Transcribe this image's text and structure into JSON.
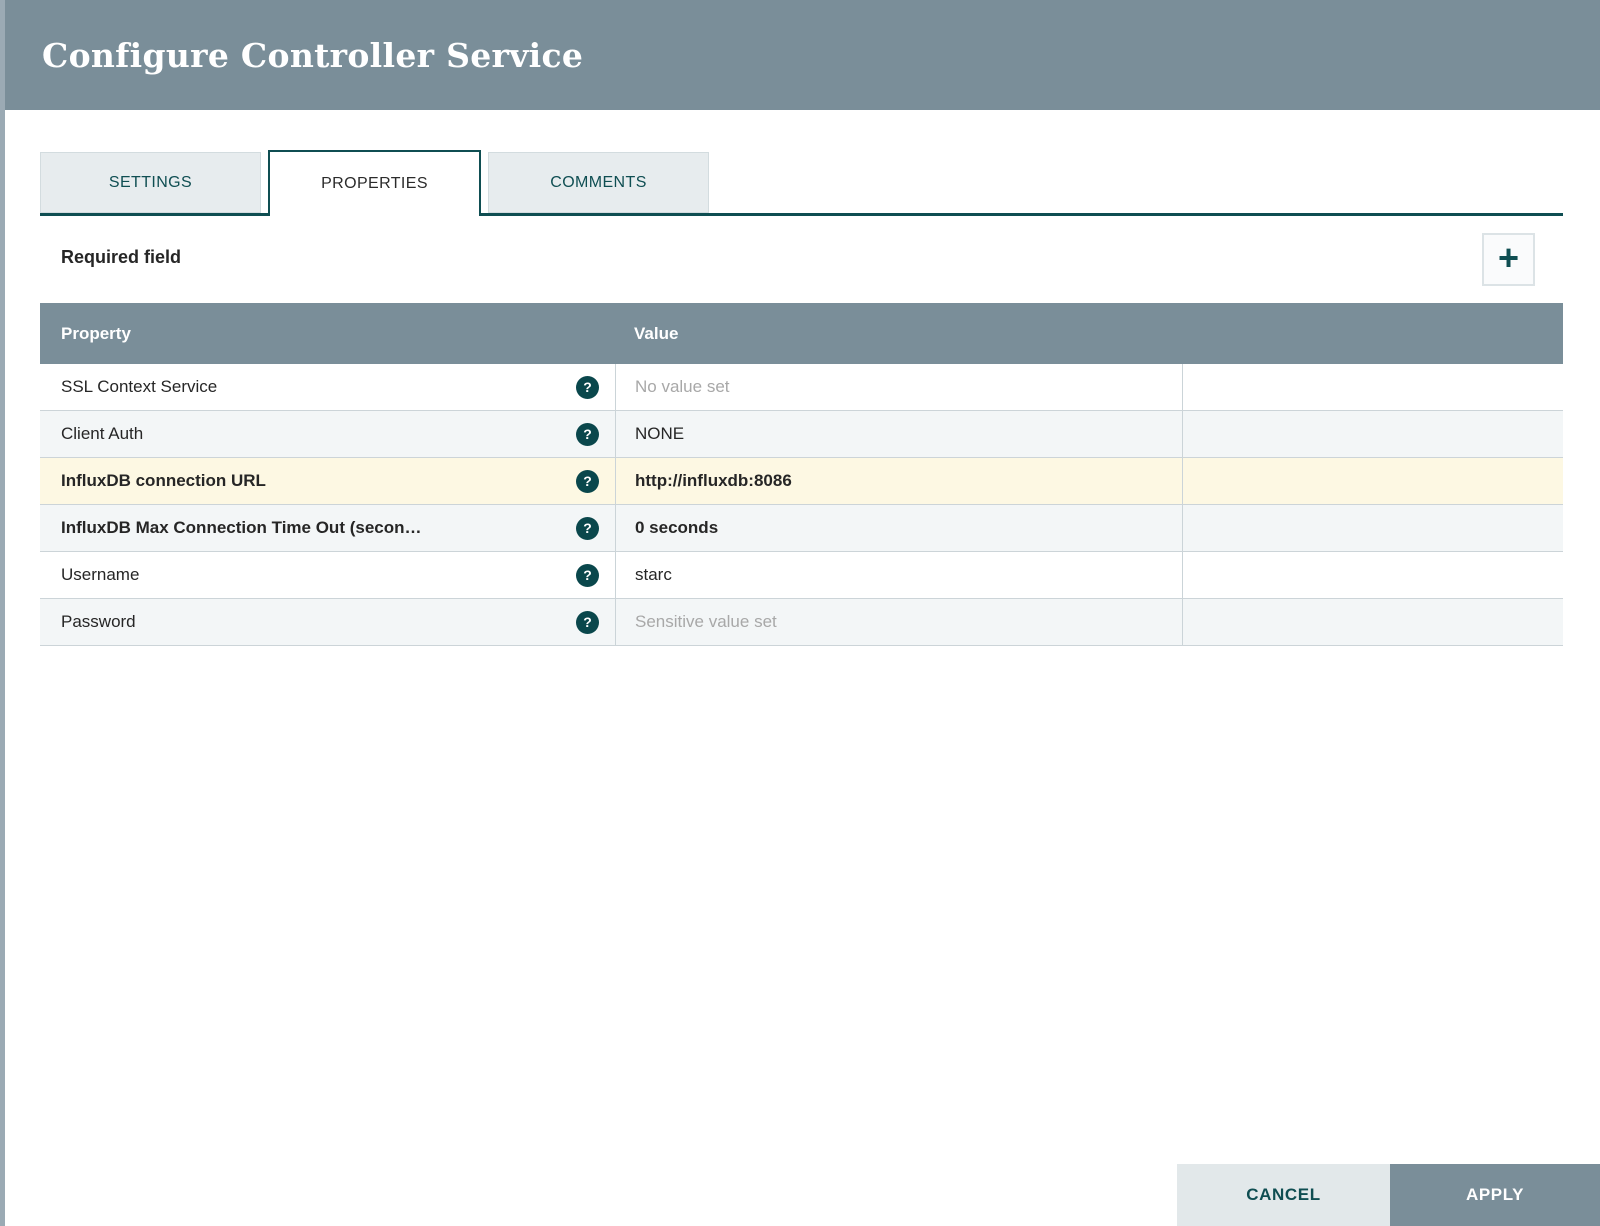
{
  "dialog": {
    "title": "Configure Controller Service",
    "tabs": [
      {
        "label": "SETTINGS",
        "active": false
      },
      {
        "label": "PROPERTIES",
        "active": true
      },
      {
        "label": "COMMENTS",
        "active": false
      }
    ],
    "required_label": "Required field",
    "add_button_icon": "+",
    "table": {
      "columns": {
        "property": "Property",
        "value": "Value"
      },
      "help_icon": "?",
      "rows": [
        {
          "property": "SSL Context Service",
          "value": "No value set",
          "value_state": "unset",
          "emphasis": false,
          "highlighted": false
        },
        {
          "property": "Client Auth",
          "value": "NONE",
          "value_state": "set",
          "emphasis": false,
          "highlighted": false
        },
        {
          "property": "InfluxDB connection URL",
          "value": "http://influxdb:8086",
          "value_state": "set",
          "emphasis": true,
          "highlighted": true
        },
        {
          "property": "InfluxDB Max Connection Time Out (secon…",
          "value": "0 seconds",
          "value_state": "set",
          "emphasis": true,
          "highlighted": false
        },
        {
          "property": "Username",
          "value": "starc",
          "value_state": "set",
          "emphasis": false,
          "highlighted": false
        },
        {
          "property": "Password",
          "value": "Sensitive value set",
          "value_state": "sensitive",
          "emphasis": false,
          "highlighted": false
        }
      ]
    },
    "footer_buttons": {
      "cancel": "CANCEL",
      "apply": "APPLY"
    },
    "colors": {
      "header_bg": "#7A8E99",
      "accent": "#0F4E52",
      "row_alt_bg": "#F3F6F7",
      "row_highlight_bg": "#FDF8E3",
      "muted_value_text": "#A8A8A8",
      "cancel_bg": "#E2E8EA",
      "apply_bg": "#7A8E99",
      "help_icon_bg": "#0A474C"
    }
  }
}
